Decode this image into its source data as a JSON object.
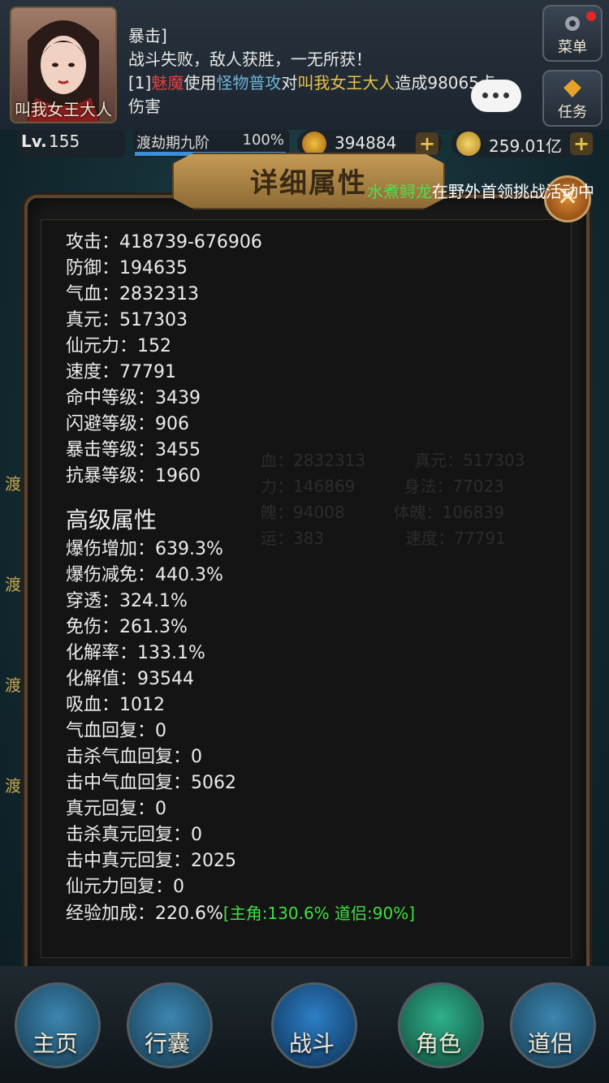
{
  "player": {
    "name": "叫我女王大人"
  },
  "chat": {
    "lines": [
      "暴击]",
      "战斗失败，敌人获胜，一无所获！"
    ],
    "battle": {
      "prefix": "[1]",
      "monster": "魅魔",
      "used": "使用",
      "skill": "怪物普攻",
      "on": "对",
      "target": "叫我女王大人",
      "dealt": "造成98065",
      "tail": "点",
      "last": "伤害"
    }
  },
  "side_buttons": {
    "menu": "菜单",
    "quest": "任务"
  },
  "stats": {
    "lv_label": "Lv.",
    "level": "155",
    "realm": "渡劫期九阶",
    "realm_progress": "100%",
    "gems": "394884",
    "gold": "259.01亿",
    "plus": "+"
  },
  "broadcast": {
    "name": "水煮鲟龙",
    "text": "在野外首领挑战活动中"
  },
  "panel": {
    "title": "详细属性",
    "close": "✕",
    "basic": [
      "攻击：418739-676906",
      "防御：194635",
      "气血：2832313",
      "真元：517303",
      "仙元力：152",
      "速度：77791",
      "命中等级：3439",
      "闪避等级：906",
      "暴击等级：3455",
      "抗暴等级：1960"
    ],
    "advanced_title": "高级属性",
    "advanced": [
      "爆伤增加：639.3%",
      "爆伤减免：440.3%",
      "穿透：324.1%",
      "免伤：261.3%",
      "化解率：133.1%",
      "化解值：93544",
      "吸血：1012",
      "气血回复：0",
      "击杀气血回复：0",
      "击中气血回复：5062",
      "真元回复：0",
      "击杀真元回复：0",
      "击中真元回复：2025",
      "仙元力回复：0"
    ],
    "exp_label": "经验加成：220.6%",
    "exp_detail": "[主角:130.6% 道侣:90%]"
  },
  "ghost": [
    [
      "血：2832313",
      "真元：517303"
    ],
    [
      "力：146869",
      "身法：77023"
    ],
    [
      "魄：94008",
      "体魄：106839"
    ],
    [
      "运：383",
      "速度：77791"
    ]
  ],
  "side_peek": [
    "渡",
    "渡",
    "渡",
    "渡"
  ],
  "nav": [
    "主页",
    "行囊",
    "战斗",
    "角色",
    "道侣"
  ],
  "colors": {
    "accent_green": "#3fe03f",
    "monster_red": "#e04242",
    "gold": "#e6c24a"
  }
}
